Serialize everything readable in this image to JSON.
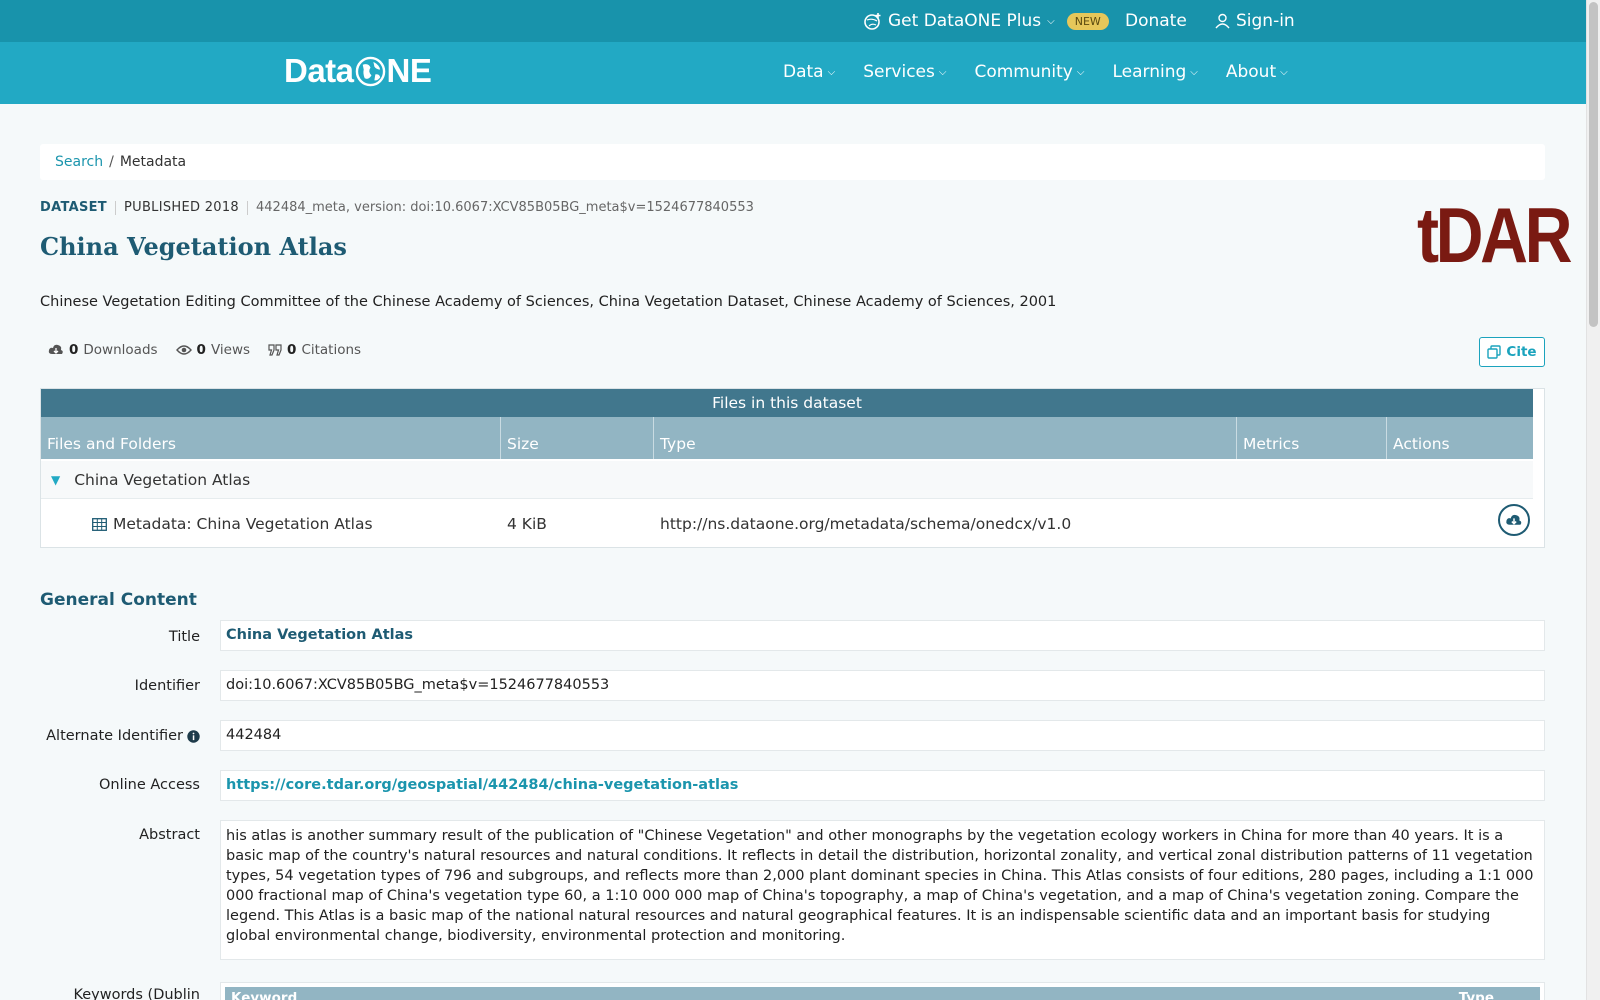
{
  "topbar": {
    "plus_label": "Get DataONE Plus",
    "new_badge": "NEW",
    "donate": "Donate",
    "signin": "Sign-in"
  },
  "navbar": {
    "logo_left": "Data",
    "logo_right": "NE",
    "items": [
      "Data",
      "Services",
      "Community",
      "Learning",
      "About"
    ]
  },
  "breadcrumb": {
    "search": "Search",
    "separator": "/",
    "current": "Metadata"
  },
  "dataset": {
    "type": "DATASET",
    "published": "PUBLISHED 2018",
    "version": "442484_meta, version: doi:10.6067:XCV85B05BG_meta$v=1524677840553",
    "title": "China Vegetation Atlas",
    "repo_logo": "tDAR",
    "citation": "Chinese Vegetation Editing Committee of the Chinese Academy of Sciences, China Vegetation Dataset, Chinese Academy of Sciences, 2001"
  },
  "metrics": {
    "downloads_count": "0",
    "downloads_label": "Downloads",
    "views_count": "0",
    "views_label": "Views",
    "citations_count": "0",
    "citations_label": "Citations",
    "cite_button": "Cite"
  },
  "files": {
    "title": "Files in this dataset",
    "headers": [
      "Files and Folders",
      "Size",
      "Type",
      "Metrics",
      "Actions"
    ],
    "folder": "China Vegetation Atlas",
    "file_name": "Metadata: China Vegetation Atlas",
    "file_size": "4 KiB",
    "file_type": "http://ns.dataone.org/metadata/schema/onedcx/v1.0"
  },
  "general": {
    "section_title": "General Content",
    "title_label": "Title",
    "title_value": "China Vegetation Atlas",
    "identifier_label": "Identifier",
    "identifier_value": "doi:10.6067:XCV85B05BG_meta$v=1524677840553",
    "alt_id_label": "Alternate Identifier",
    "alt_id_value": "442484",
    "online_label": "Online Access",
    "online_value": "https://core.tdar.org/geospatial/442484/china-vegetation-atlas",
    "abstract_label": "Abstract",
    "abstract_value": "his atlas is another summary result of the publication of \"Chinese Vegetation\" and other monographs by the vegetation ecology workers in China for more than 40 years. It is a basic map of the country's natural resources and natural conditions. It reflects in detail the distribution, horizontal zonality, and vertical zonal distribution patterns of 11 vegetation types, 54 vegetation types of 796 and subgroups, and reflects more than 2,000 plant dominant species in China. This Atlas consists of four editions, 280 pages, including a 1:1 000 000 fractional map of China's vegetation type 60, a 1:10 000 000 map of China's topography, a map of China's vegetation, and a map of China's vegetation zoning. Compare the legend. This Atlas is a basic map of the national natural resources and natural geographical features. It is an indispensable scientific data and an important basis for studying global environmental change, biodiversity, environmental protection and monitoring.",
    "keywords_label": "Keywords (Dublin",
    "kw_col_keyword": "Keyword",
    "kw_col_type": "Type"
  },
  "colors": {
    "topbar": "#1893ab",
    "navbar": "#22a9c4",
    "title": "#1e5b73",
    "tdar": "#7a1a12"
  }
}
